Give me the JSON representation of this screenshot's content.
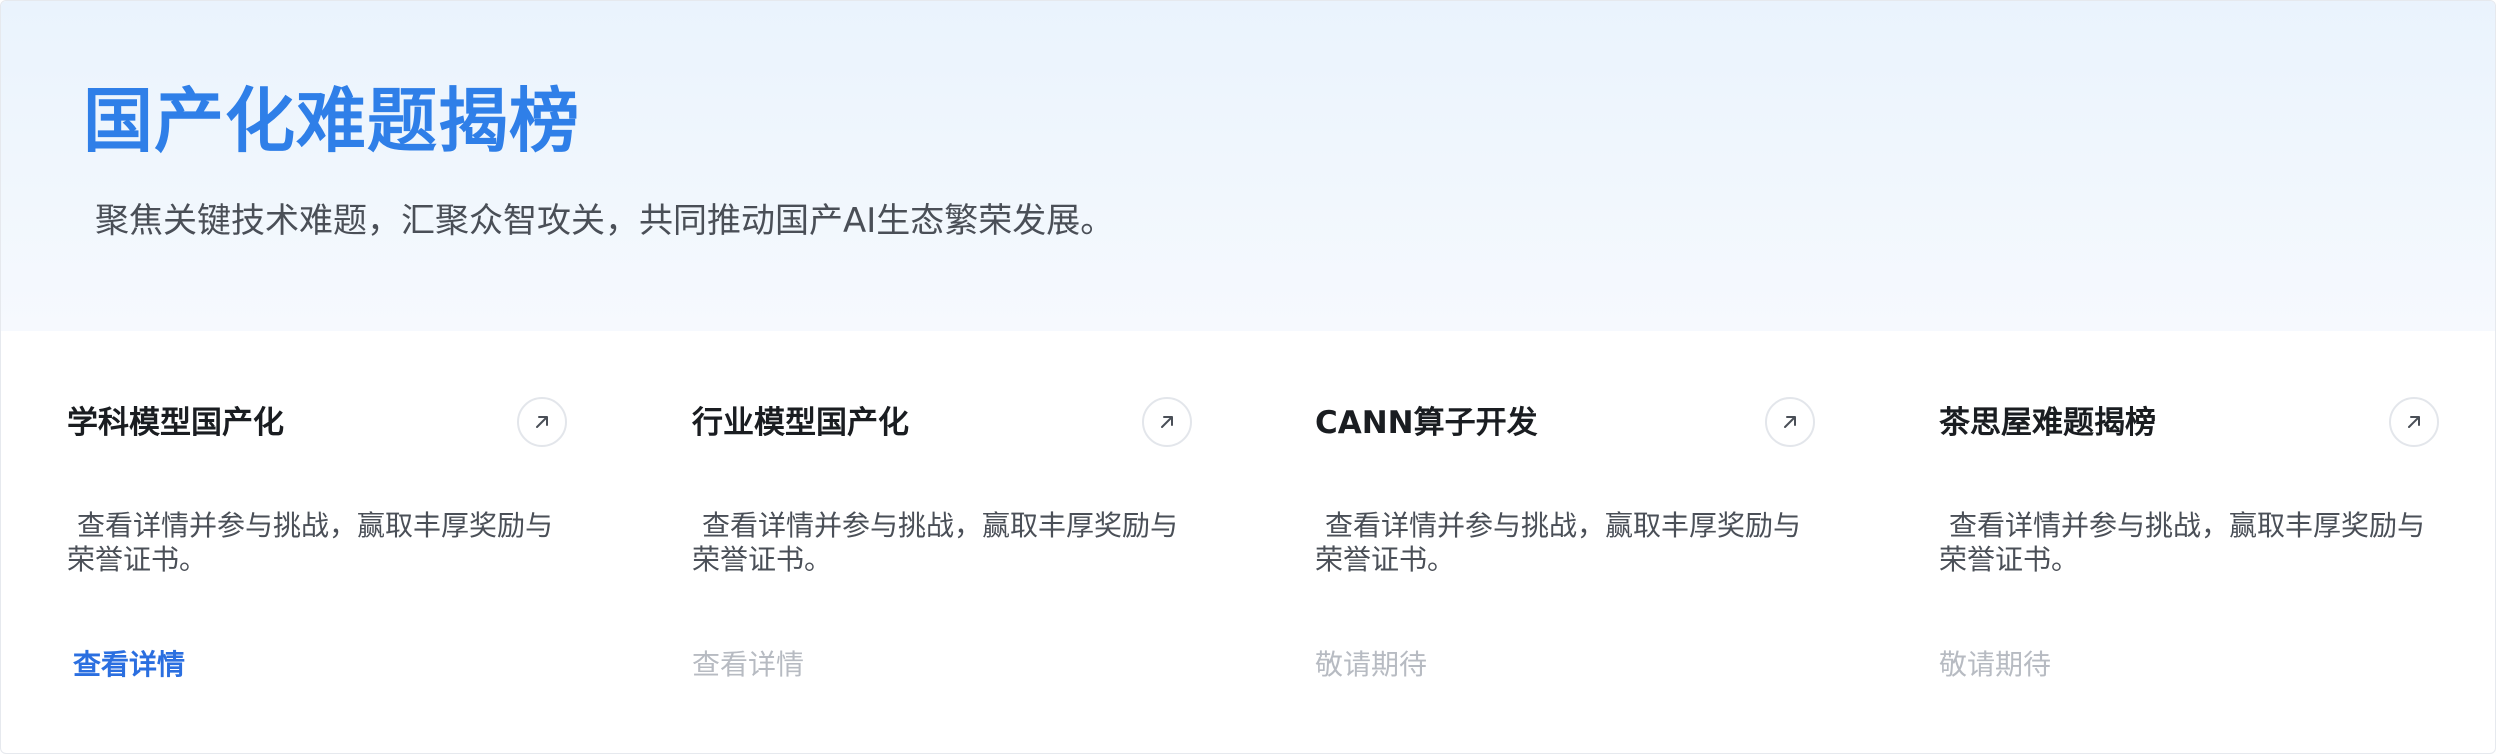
{
  "hero": {
    "title": "国产化难题揭榜",
    "subtitle": "聚焦关键技术难题，汇聚众智攻关，共同推动国产AI生态繁荣发展。"
  },
  "cards": [
    {
      "title": "学科模型国产化",
      "description": "查看详情并参与挑战，赢取丰厚奖励与荣誉证书。",
      "link_label": "查看详情",
      "arrow_icon": "arrow-up-right-icon"
    },
    {
      "title": "行业模型国产化",
      "description": "查看详情并参与挑战，赢取丰厚奖励与荣誉证书。",
      "link_label": "查看详情",
      "arrow_icon": "arrow-up-right-icon"
    },
    {
      "title": "CANN算子开发",
      "description": "查看详情并参与挑战，赢取丰厚奖励与荣誉证书。",
      "link_label": "敬请期待",
      "arrow_icon": "arrow-up-right-icon"
    },
    {
      "title": "茶思屋难题揭榜",
      "description": "查看详情并参与挑战，赢取丰厚奖励与荣誉证书。",
      "link_label": "敬请期待",
      "arrow_icon": "arrow-up-right-icon"
    }
  ],
  "colors": {
    "accent": "#2f7fe8",
    "link_active": "#2b6fe0",
    "link_disabled": "#b7bbc2",
    "hero_bg": "#eaf3fd"
  }
}
